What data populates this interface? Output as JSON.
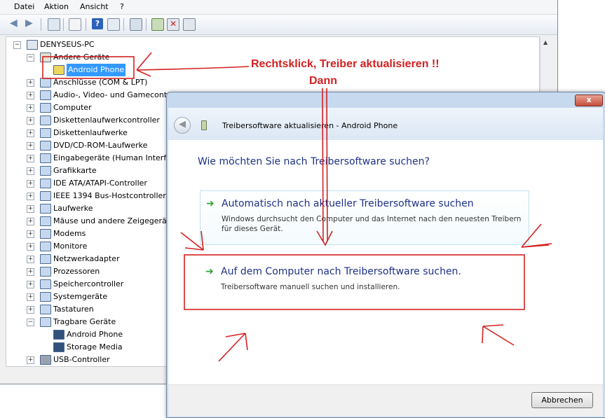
{
  "menu": [
    "Datei",
    "Aktion",
    "Ansicht",
    "?"
  ],
  "tree": {
    "root": "DENYSEUS-PC",
    "other_devices": "Andere Geräte",
    "selected_device": "Android Phone",
    "categories": [
      "Anschlüsse (COM & LPT)",
      "Audio-, Video- und Gamecontroller",
      "Computer",
      "Diskettenlaufwerkcontroller",
      "Diskettenlaufwerke",
      "DVD/CD-ROM-Laufwerke",
      "Eingabegeräte (Human Interface Devices)",
      "Grafikkarte",
      "IDE ATA/ATAPI-Controller",
      "IEEE 1394 Bus-Hostcontroller",
      "Laufwerke",
      "Mäuse und andere Zeigegeräte",
      "Modems",
      "Monitore",
      "Netzwerkadapter",
      "Prozessoren",
      "Speichercontroller",
      "Systemgeräte",
      "Tastaturen",
      "Tragbare Geräte"
    ],
    "portable_children": [
      "Android Phone",
      "Storage Media"
    ],
    "last": "USB-Controller"
  },
  "dialog": {
    "close": "x",
    "header_title": "Treibersoftware aktualisieren - Android Phone",
    "question": "Wie möchten Sie nach Treibersoftware suchen?",
    "option1_title": "Automatisch nach aktueller Treibersoftware suchen",
    "option1_desc_line1": "Windows durchsucht den Computer und das Internet nach den neuesten Treibern",
    "option1_desc_line2": "für dieses Gerät.",
    "option2_title": "Auf dem Computer nach Treibersoftware suchen.",
    "option2_desc": "Treibersoftware manuell suchen und installieren.",
    "cancel": "Abbrechen"
  },
  "annotations": {
    "line1": "Rechtsklick, Treiber aktualisieren !!",
    "line2": "Dann"
  },
  "colors": {
    "annotation_red": "#d42121",
    "selection_blue": "#3399ff",
    "link_blue": "#1e3287",
    "arrow_green": "#2da537"
  }
}
